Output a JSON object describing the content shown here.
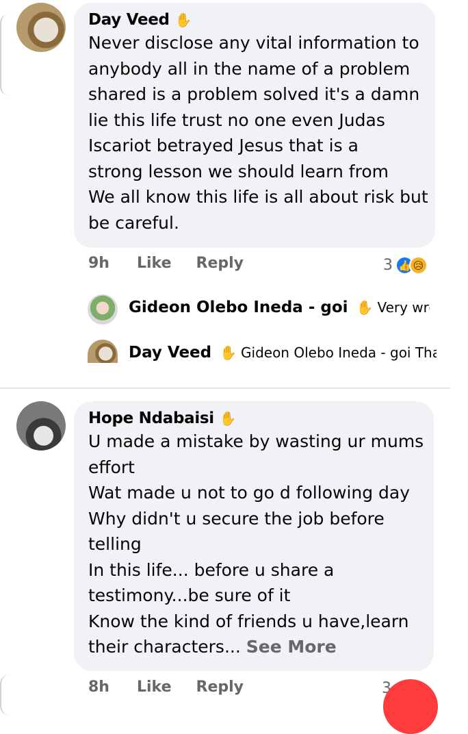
{
  "comments": [
    {
      "author": "Day Veed",
      "author_icon": "waving-hand-icon",
      "lines": [
        "Never disclose any vital information to",
        "anybody all in the name of a problem",
        "shared is a problem solved it's a damn",
        "lie this life trust no one even Judas",
        "Iscariot betrayed Jesus that is a",
        "strong lesson we should learn from",
        "We all know this life is all about risk but",
        "be careful."
      ],
      "time": "9h",
      "like": "Like",
      "reply": "Reply",
      "reaction_count": "3",
      "reactions": [
        "like-icon",
        "sad-icon"
      ],
      "replies": [
        {
          "name": "Gideon Olebo Ineda - goi",
          "text": "Very wrong,..."
        },
        {
          "name": "Day Veed",
          "text": "Gideon Olebo Ineda - goi That..."
        }
      ]
    },
    {
      "author": "Hope Ndabaisi",
      "author_icon": "waving-hand-icon",
      "lines": [
        "U made a mistake by wasting ur mums",
        "effort",
        "Wat made u not to go d following day",
        "Why didn't u secure the job before",
        "telling",
        "In this life... before u share a",
        "testimony...be sure of it",
        "Know the kind of friends u have,learn"
      ],
      "last_line": "their characters...",
      "see_more": "See More",
      "time": "8h",
      "like": "Like",
      "reply": "Reply",
      "reaction_count": "3"
    }
  ],
  "colors": {
    "bubble": "#f0f2f5",
    "meta": "#65676b",
    "like": "#1877f2",
    "sad": "#f7b125",
    "fab": "#ff3d3d"
  }
}
